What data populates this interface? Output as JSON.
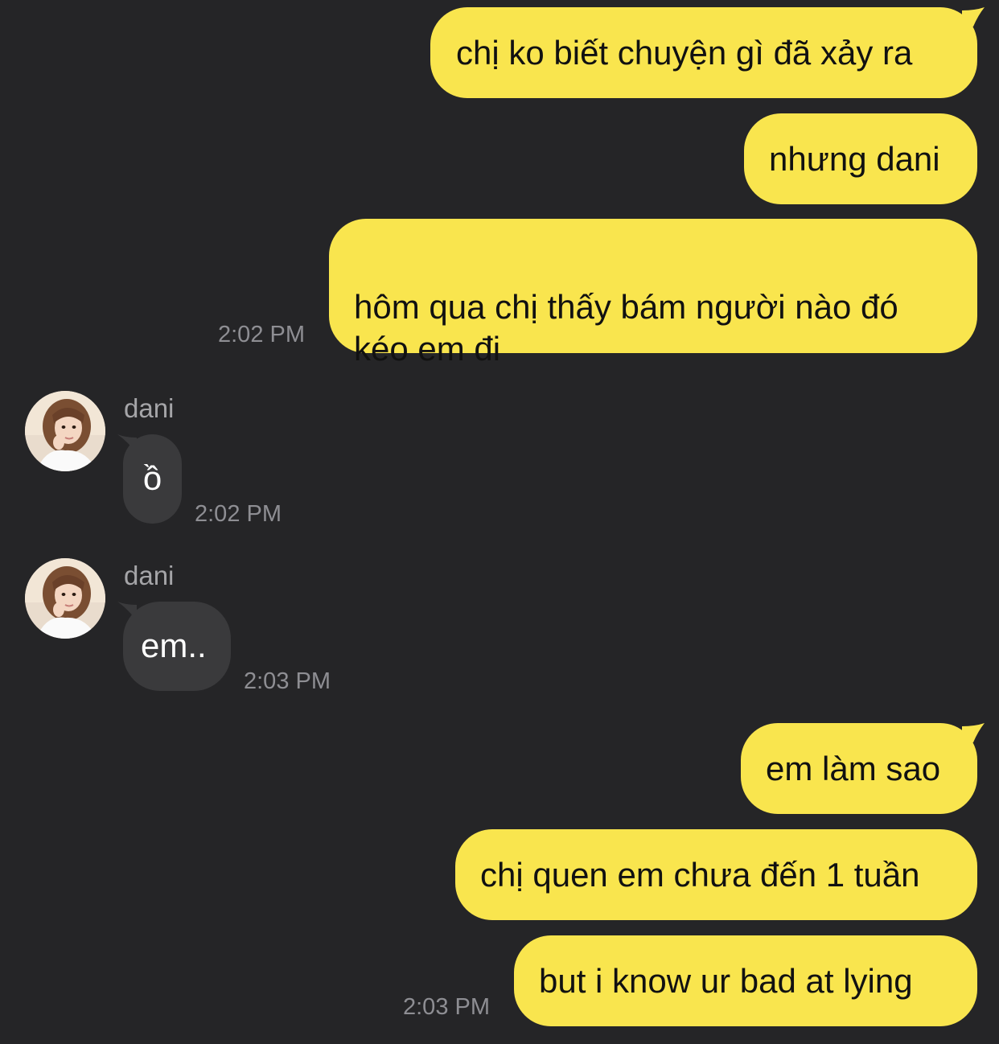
{
  "conversation": {
    "outgoing_group_1": [
      {
        "text": "chị ko biết chuyện gì đã xảy ra"
      },
      {
        "text": "nhưng dani"
      },
      {
        "text": "hôm qua chị thấy bám người nào đó\nkéo em đi"
      }
    ],
    "outgoing_group_1_time": "2:02 PM",
    "incoming_1": {
      "sender": "dani",
      "text": "ồ",
      "time": "2:02 PM"
    },
    "incoming_2": {
      "sender": "dani",
      "text": "em..",
      "time": "2:03 PM"
    },
    "outgoing_group_2": [
      {
        "text": "em làm sao"
      },
      {
        "text": "chị quen em chưa đến 1 tuần"
      },
      {
        "text": "but i know ur bad at lying"
      }
    ],
    "outgoing_group_2_time": "2:03 PM"
  },
  "colors": {
    "background": "#252527",
    "outgoing_bubble": "#F9E54E",
    "incoming_bubble": "#3A3A3C",
    "timestamp": "#8E8E93"
  },
  "icons": {
    "avatar": "profile-photo-avatar"
  }
}
